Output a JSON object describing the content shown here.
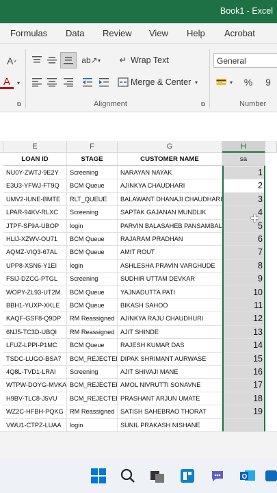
{
  "window": {
    "title": "Book1 - Excel"
  },
  "menu_tabs": [
    "Formulas",
    "Data",
    "Review",
    "View",
    "Help",
    "Acrobat"
  ],
  "ribbon": {
    "wrap_text_label": "Wrap Text",
    "merge_center_label": "Merge & Center",
    "alignment_group_label": "Alignment",
    "number_group_label": "Number",
    "number_format_value": "General",
    "percent_symbol": "%",
    "comma_symbol": "9"
  },
  "columns": {
    "letters": [
      "E",
      "F",
      "G",
      "H"
    ],
    "headers": [
      "LOAN ID",
      "STAGE",
      "CUSTOMER NAME",
      "sa"
    ]
  },
  "rows": [
    {
      "loan_id": "NU0Y-ZWTJ-9E2Y",
      "stage": "Screening",
      "customer": "NARAYAN NAYAK",
      "sa": "1"
    },
    {
      "loan_id": "E3U3-YFWJ-FT9Q",
      "stage": "BCM Queue",
      "customer": "AJINKYA CHAUDHARI",
      "sa": "2"
    },
    {
      "loan_id": "UMV2-IUNE-BMTE",
      "stage": "RLT_QUEUE",
      "customer": "BALAWANT DHANAJI CHAUDHARI",
      "sa": "3"
    },
    {
      "loan_id": "LPAR-94KV-RLXC",
      "stage": "Screening",
      "customer": "SAPTAK GAJANAN MUNDLIK",
      "sa": "4"
    },
    {
      "loan_id": "JTPF-SF9A-UBOP",
      "stage": "login",
      "customer": "PARVIN BALASAHEB PANSAMBAL",
      "sa": "5"
    },
    {
      "loan_id": "HLIJ-XZWV-OU71",
      "stage": "BCM Queue",
      "customer": "RAJARAM PRADHAN",
      "sa": "6"
    },
    {
      "loan_id": "AQMZ-VIQ3-67AL",
      "stage": "BCM Queue",
      "customer": "AMIT ROUT",
      "sa": "7"
    },
    {
      "loan_id": "UPP8-XSN6-Y1EI",
      "stage": "login",
      "customer": "ASHLESHA PRAVIN VARGHUDE",
      "sa": "8"
    },
    {
      "loan_id": "FSIJ-DZCG-PTGL",
      "stage": "Screening",
      "customer": "SUDHIR UTTAM DEVKAR",
      "sa": "9"
    },
    {
      "loan_id": "WOPY-ZL93-UT2M",
      "stage": "BCM Queue",
      "customer": "YAJNADUTTA PATI",
      "sa": "10"
    },
    {
      "loan_id": "BBH1-YUXP-XKLE",
      "stage": "BCM Queue",
      "customer": "BIKASH SAHOO",
      "sa": "11"
    },
    {
      "loan_id": "KAQF-GSF8-Q9DP",
      "stage": "RM Reassigned",
      "customer": "AJINKYA RAJU CHAUDHURI",
      "sa": "12"
    },
    {
      "loan_id": "6NJ5-TC3D-UBQI",
      "stage": "RM Reassigned",
      "customer": "AJIT SHINDE",
      "sa": "13"
    },
    {
      "loan_id": "LFUZ-LPPI-P1MC",
      "stage": "BCM Queue",
      "customer": "RAJESH KUMAR DAS",
      "sa": "14"
    },
    {
      "loan_id": "TSDC-LUGO-BSA7",
      "stage": "BCM_REJECTED",
      "customer": "DIPAK SHRIMANT AURWASE",
      "sa": "15"
    },
    {
      "loan_id": "4Q8L-TVD1-LRAI",
      "stage": "Screening",
      "customer": "AJIT SHIVAJI MANE",
      "sa": "16"
    },
    {
      "loan_id": "WTPW-DOYG-MVKA",
      "stage": "BCM_REJECTED",
      "customer": "AMOL NIVRUTTI SONAVNE",
      "sa": "17"
    },
    {
      "loan_id": "H9BV-TLC8-J5VU",
      "stage": "BCM_REJECTED",
      "customer": "PRASHANT ARJUN UMATE",
      "sa": "18"
    },
    {
      "loan_id": "WZ2C-HFBH-PQKG",
      "stage": "RM Reassigned",
      "customer": "SATISH SAHEBRAO THORAT",
      "sa": "19"
    },
    {
      "loan_id": "VWU1-CTPZ-LUAA",
      "stage": "login",
      "customer": "SUNIL PRAKASH NISHANE",
      "sa": ""
    }
  ],
  "colors": {
    "excel_green": "#1e7145",
    "selection": "#217346",
    "selected_fill": "#d9d9d9"
  }
}
